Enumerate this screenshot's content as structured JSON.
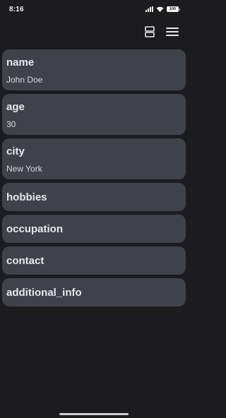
{
  "status_bar": {
    "time": "8:16",
    "battery": "100"
  },
  "toolbar": {
    "layout_icon": "layout-toggle-icon",
    "menu_icon": "hamburger-menu-icon"
  },
  "fields": [
    {
      "key": "name",
      "value": "John Doe"
    },
    {
      "key": "age",
      "value": "30"
    },
    {
      "key": "city",
      "value": "New York"
    },
    {
      "key": "hobbies"
    },
    {
      "key": "occupation"
    },
    {
      "key": "contact"
    },
    {
      "key": "additional_info"
    }
  ],
  "colors": {
    "background": "#1c1c1e",
    "card": "#40424a",
    "text": "#e6e7ec"
  }
}
